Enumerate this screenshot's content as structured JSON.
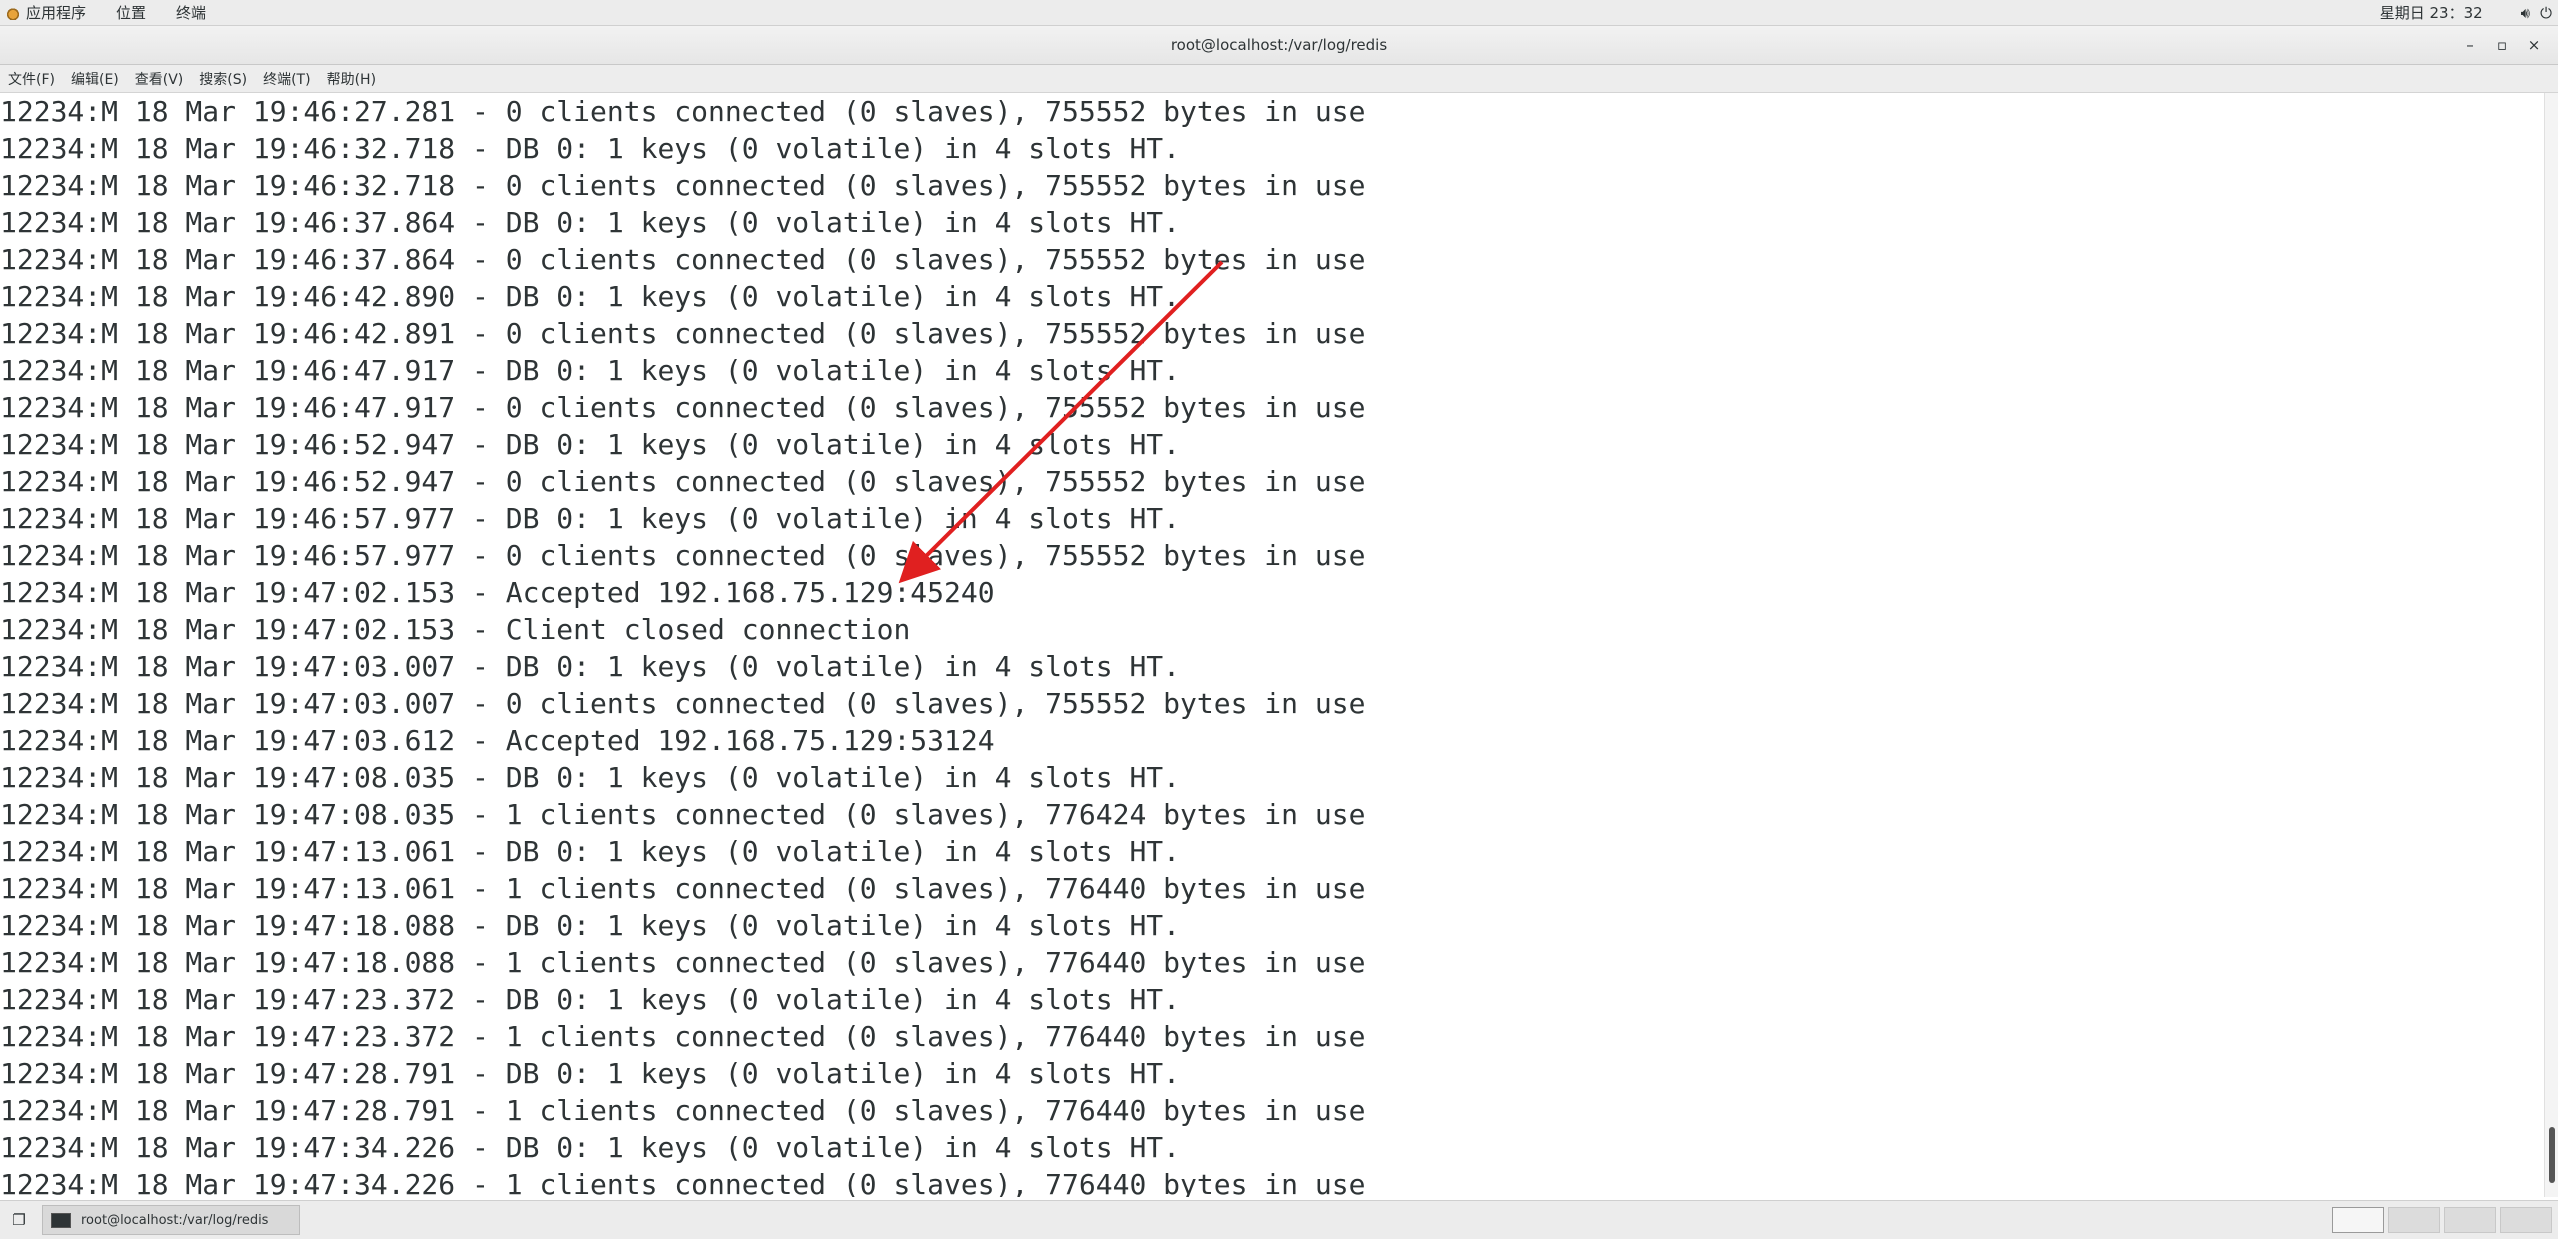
{
  "topbar": {
    "applications": "应用程序",
    "places": "位置",
    "terminal": "终端",
    "clock": "星期日 23：32",
    "volume_icon": "volume-icon",
    "power_icon": "power-icon"
  },
  "window": {
    "title": "root@localhost:/var/log/redis",
    "minimize": "–",
    "maximize": "▫",
    "close": "×"
  },
  "menubar": [
    "文件(F)",
    "编辑(E)",
    "查看(V)",
    "搜索(S)",
    "终端(T)",
    "帮助(H)"
  ],
  "log_lines": [
    "12234:M 18 Mar 19:46:27.281 - 0 clients connected (0 slaves), 755552 bytes in use",
    "12234:M 18 Mar 19:46:32.718 - DB 0: 1 keys (0 volatile) in 4 slots HT.",
    "12234:M 18 Mar 19:46:32.718 - 0 clients connected (0 slaves), 755552 bytes in use",
    "12234:M 18 Mar 19:46:37.864 - DB 0: 1 keys (0 volatile) in 4 slots HT.",
    "12234:M 18 Mar 19:46:37.864 - 0 clients connected (0 slaves), 755552 bytes in use",
    "12234:M 18 Mar 19:46:42.890 - DB 0: 1 keys (0 volatile) in 4 slots HT.",
    "12234:M 18 Mar 19:46:42.891 - 0 clients connected (0 slaves), 755552 bytes in use",
    "12234:M 18 Mar 19:46:47.917 - DB 0: 1 keys (0 volatile) in 4 slots HT.",
    "12234:M 18 Mar 19:46:47.917 - 0 clients connected (0 slaves), 755552 bytes in use",
    "12234:M 18 Mar 19:46:52.947 - DB 0: 1 keys (0 volatile) in 4 slots HT.",
    "12234:M 18 Mar 19:46:52.947 - 0 clients connected (0 slaves), 755552 bytes in use",
    "12234:M 18 Mar 19:46:57.977 - DB 0: 1 keys (0 volatile) in 4 slots HT.",
    "12234:M 18 Mar 19:46:57.977 - 0 clients connected (0 slaves), 755552 bytes in use",
    "12234:M 18 Mar 19:47:02.153 - Accepted 192.168.75.129:45240",
    "12234:M 18 Mar 19:47:02.153 - Client closed connection",
    "12234:M 18 Mar 19:47:03.007 - DB 0: 1 keys (0 volatile) in 4 slots HT.",
    "12234:M 18 Mar 19:47:03.007 - 0 clients connected (0 slaves), 755552 bytes in use",
    "12234:M 18 Mar 19:47:03.612 - Accepted 192.168.75.129:53124",
    "12234:M 18 Mar 19:47:08.035 - DB 0: 1 keys (0 volatile) in 4 slots HT.",
    "12234:M 18 Mar 19:47:08.035 - 1 clients connected (0 slaves), 776424 bytes in use",
    "12234:M 18 Mar 19:47:13.061 - DB 0: 1 keys (0 volatile) in 4 slots HT.",
    "12234:M 18 Mar 19:47:13.061 - 1 clients connected (0 slaves), 776440 bytes in use",
    "12234:M 18 Mar 19:47:18.088 - DB 0: 1 keys (0 volatile) in 4 slots HT.",
    "12234:M 18 Mar 19:47:18.088 - 1 clients connected (0 slaves), 776440 bytes in use",
    "12234:M 18 Mar 19:47:23.372 - DB 0: 1 keys (0 volatile) in 4 slots HT.",
    "12234:M 18 Mar 19:47:23.372 - 1 clients connected (0 slaves), 776440 bytes in use",
    "12234:M 18 Mar 19:47:28.791 - DB 0: 1 keys (0 volatile) in 4 slots HT.",
    "12234:M 18 Mar 19:47:28.791 - 1 clients connected (0 slaves), 776440 bytes in use",
    "12234:M 18 Mar 19:47:34.226 - DB 0: 1 keys (0 volatile) in 4 slots HT.",
    "12234:M 18 Mar 19:47:34.226 - 1 clients connected (0 slaves), 776440 bytes in use"
  ],
  "annotation": {
    "color": "#e02020",
    "icon": "red-arrow-icon"
  },
  "taskbar": {
    "task_label": "root@localhost:/var/log/redis",
    "workspace_count": 4,
    "active_workspace": 1
  }
}
